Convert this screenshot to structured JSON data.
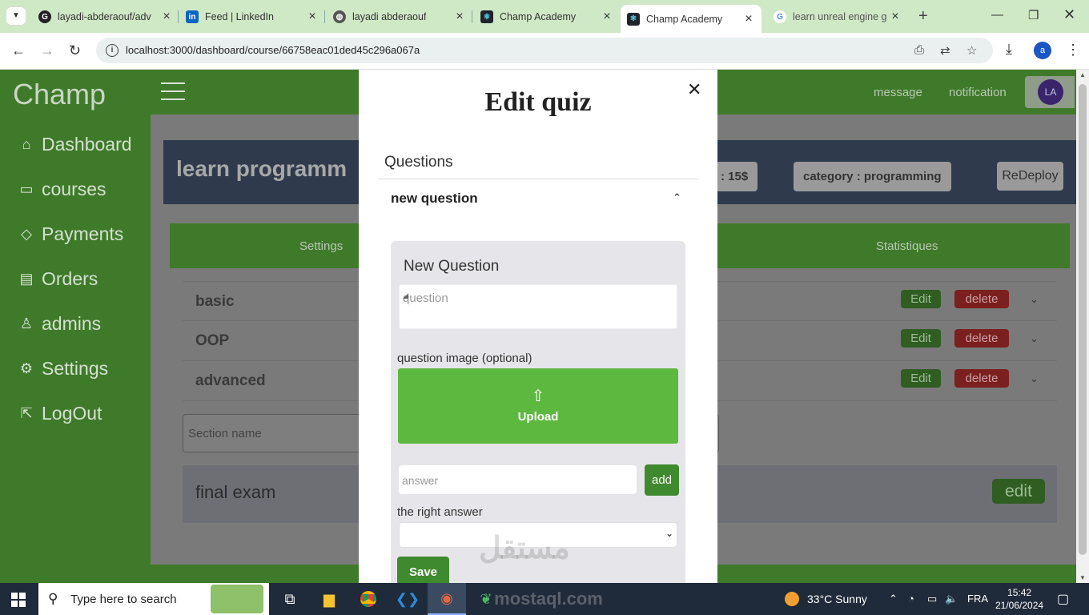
{
  "browser": {
    "tabs": [
      {
        "title": "layadi-abderaouf/adv",
        "icon": "github-icon"
      },
      {
        "title": "Feed | LinkedIn",
        "icon": "linkedin-icon"
      },
      {
        "title": "layadi abderaouf",
        "icon": "globe-icon"
      },
      {
        "title": "Champ Academy",
        "icon": "react-icon"
      },
      {
        "title": "Champ Academy",
        "icon": "react-icon",
        "active": true
      },
      {
        "title": "learn unreal engine g",
        "icon": "google-icon"
      }
    ],
    "url": "localhost:3000/dashboard/course/66758eac01ded45c296a067a",
    "profile_initial": "a"
  },
  "sidebar": {
    "brand": "Champ",
    "items": [
      {
        "label": "Dashboard",
        "icon": "home-icon"
      },
      {
        "label": "courses",
        "icon": "archive-icon"
      },
      {
        "label": "Payments",
        "icon": "tag-icon"
      },
      {
        "label": "Orders",
        "icon": "clipboard-icon"
      },
      {
        "label": "admins",
        "icon": "user-icon"
      },
      {
        "label": "Settings",
        "icon": "gear-icon"
      },
      {
        "label": "LogOut",
        "icon": "logout-icon"
      }
    ]
  },
  "topbar": {
    "message": "message",
    "notification": "notification",
    "avatar_initials": "LA"
  },
  "course": {
    "title": "learn programm",
    "price_chip": ": 15$",
    "category_chip": "category : programming",
    "redeploy": "ReDeploy",
    "tabs": [
      "Settings",
      "Statistiques"
    ],
    "sections": [
      {
        "name": "basic"
      },
      {
        "name": "OOP"
      },
      {
        "name": "advanced"
      }
    ],
    "edit_label": "Edit",
    "delete_label": "delete",
    "section_placeholder": "Section name",
    "final_exam": "final exam",
    "final_edit": "edit"
  },
  "modal": {
    "title": "Edit quiz",
    "questions_heading": "Questions",
    "accordion_title": "new question",
    "card_title": "New Question",
    "question_placeholder": "question",
    "image_label": "question image (optional)",
    "upload_label": "Upload",
    "answer_placeholder": "answer",
    "add_label": "add",
    "right_answer_label": "the right answer",
    "save_label": "Save",
    "watermark": "مستقل"
  },
  "taskbar": {
    "search_placeholder": "Type here to search",
    "weather": "33°C  Sunny",
    "language": "FRA",
    "time": "15:42",
    "date": "21/06/2024",
    "watermark_text": "mostaql.com"
  },
  "colors": {
    "brand_green": "#3f7a2a",
    "upload_green": "#5cb83f",
    "delete_red": "#7b1f1f"
  }
}
